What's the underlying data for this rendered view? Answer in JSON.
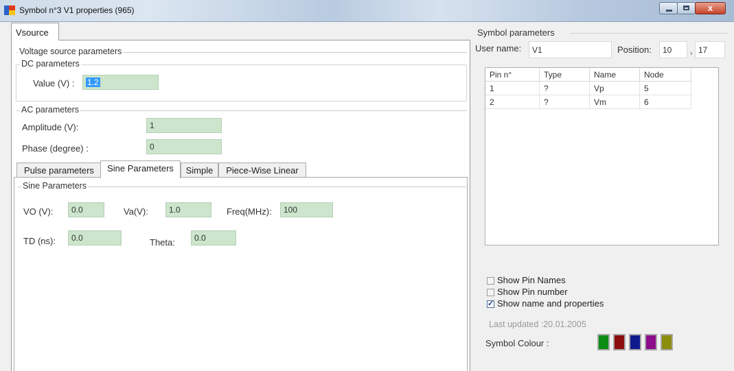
{
  "window": {
    "title": "Symbol n°3 V1 properties (965)",
    "close_glyph": "x"
  },
  "tabs": {
    "vsource": "Vsource"
  },
  "voltage_source": {
    "legend": "Voltage source parameters",
    "dc": {
      "legend": "DC parameters",
      "value_label": "Value (V) :",
      "value": "1.2"
    },
    "ac": {
      "legend": "AC parameters",
      "amplitude_label": "Amplitude (V):",
      "amplitude": "1",
      "phase_label": "Phase (degree) :",
      "phase": "0"
    }
  },
  "inner_tabs": [
    "Pulse parameters",
    "Sine Parameters",
    "Simple",
    "Piece-Wise Linear"
  ],
  "sine": {
    "legend": "Sine Parameters",
    "vo_label": "VO (V):",
    "vo": "0.0",
    "va_label": "Va(V):",
    "va": "1.0",
    "freq_label": "Freq(MHz):",
    "freq": "100",
    "td_label": "TD (ns):",
    "td": "0.0",
    "theta_label": "Theta:",
    "theta": "0.0"
  },
  "symbol": {
    "title": "Symbol parameters",
    "user_name_label": "User name:",
    "user_name": "V1",
    "position_label": "Position:",
    "pos_x": "10",
    "pos_sep": ",",
    "pos_y": "17",
    "pin_table": {
      "headers": [
        "Pin n°",
        "Type",
        "Name",
        "Node"
      ],
      "rows": [
        [
          "1",
          "?",
          "Vp",
          "5"
        ],
        [
          "2",
          "?",
          "Vm",
          "6"
        ]
      ]
    },
    "checkboxes": [
      {
        "label": "Show Pin Names",
        "checked": false
      },
      {
        "label": "Show Pin number",
        "checked": false
      },
      {
        "label": "Show name and properties",
        "checked": true
      }
    ],
    "last_updated": "Last updated :20.01.2005",
    "colour_label": "Symbol Colour :",
    "colours": [
      "#0d8c14",
      "#8c0d0d",
      "#0f1a8c",
      "#8c0d8c",
      "#8c8c0d"
    ]
  }
}
